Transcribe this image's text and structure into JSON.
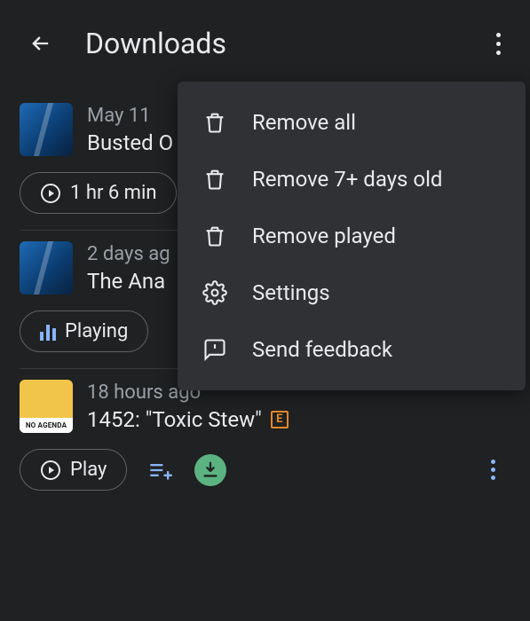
{
  "header": {
    "title": "Downloads"
  },
  "episodes": [
    {
      "date": "May 11",
      "title": "Busted O",
      "pill_label": "1 hr 6 min",
      "state": "idle"
    },
    {
      "date": "2 days ag",
      "title": "The Ana",
      "pill_label": "Playing",
      "state": "playing"
    },
    {
      "date": "18 hours ago",
      "title": "1452: \"Toxic Stew\"",
      "pill_label": "Play",
      "state": "idle",
      "explicit": "E",
      "thumb_label": "NO AGENDA"
    }
  ],
  "menu": {
    "items": [
      {
        "icon": "trash-icon",
        "label": "Remove all"
      },
      {
        "icon": "trash-icon",
        "label": "Remove 7+ days old"
      },
      {
        "icon": "trash-icon",
        "label": "Remove played"
      },
      {
        "icon": "gear-icon",
        "label": "Settings"
      },
      {
        "icon": "feedback-icon",
        "label": "Send feedback"
      }
    ]
  }
}
